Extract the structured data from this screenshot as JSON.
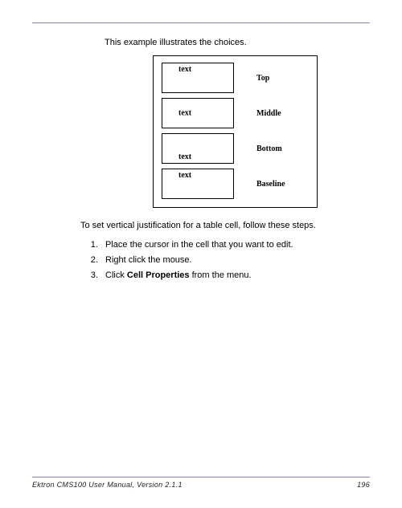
{
  "intro_text": "This example illustrates the choices.",
  "diagram": {
    "cell_text": "text",
    "rows": [
      {
        "align": "top",
        "label": "Top"
      },
      {
        "align": "middle",
        "label": "Middle"
      },
      {
        "align": "bottom",
        "label": "Bottom"
      },
      {
        "align": "baseline",
        "label": "Baseline"
      }
    ]
  },
  "instruction": "To set vertical justification for a table cell, follow these steps.",
  "steps": {
    "s1": "Place the cursor in the cell that you want to edit.",
    "s2": "Right click the mouse.",
    "s3_prefix": "Click ",
    "s3_bold": "Cell Properties",
    "s3_suffix": " from the menu."
  },
  "footer": {
    "left": "Ektron CMS100 User Manual, Version 2.1.1",
    "right": "196"
  }
}
